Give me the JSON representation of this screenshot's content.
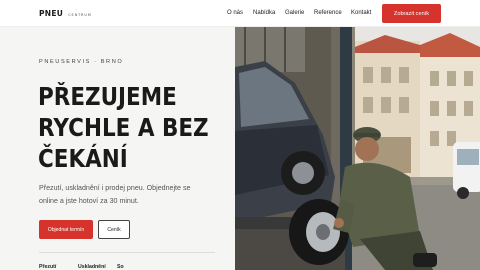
{
  "brand": {
    "name": "PNEU",
    "tagline": "CENTRUM"
  },
  "nav": {
    "items": [
      {
        "label": "O nás"
      },
      {
        "label": "Nabídka"
      },
      {
        "label": "Galerie"
      },
      {
        "label": "Reference"
      },
      {
        "label": "Kontakt"
      }
    ],
    "cta_label": "Zobrazit ceník"
  },
  "hero": {
    "eyebrow": "PNEUSERVIS · BRNO",
    "headline_lines": [
      "PŘEZUJEME",
      "RYCHLE A BEZ",
      "ČEKÁNÍ"
    ],
    "lead_lines": [
      "Přezutí, uskladnění i prodej pneu. Objednejte se",
      "online a jste hotoví za 30 minut."
    ],
    "primary_button": "Objednat termín",
    "secondary_button": "Ceník",
    "image_alt": "Mechanik přezouvá pneumatiku automobilu na zvedáku",
    "stats": [
      {
        "label": "Přezutí"
      },
      {
        "label": "Uskladnění"
      },
      {
        "label": "So"
      }
    ]
  },
  "colors": {
    "accent": "#d5332b",
    "text": "#1b1b1b",
    "muted": "#555555",
    "panel": "#f5f5f4"
  }
}
